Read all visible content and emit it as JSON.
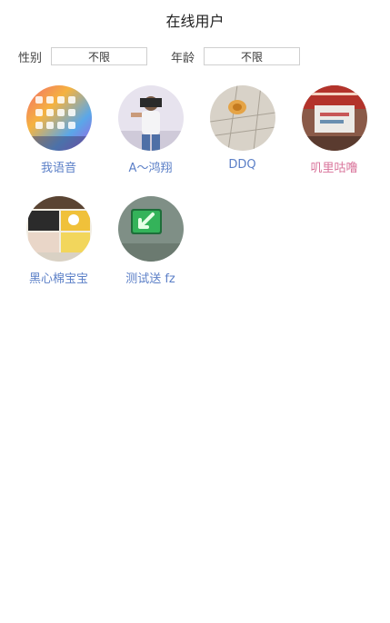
{
  "header": {
    "title": "在线用户"
  },
  "filters": {
    "gender_label": "性别",
    "gender_value": "不限",
    "age_label": "年龄",
    "age_value": "不限"
  },
  "users": [
    {
      "name": "我语音",
      "color": "#5b7fc7"
    },
    {
      "name": "A～鸿翔",
      "color": "#5b7fc7"
    },
    {
      "name": "DDQ",
      "color": "#5b7fc7"
    },
    {
      "name": "叽里咕噜",
      "color": "#d9739a"
    },
    {
      "name": "黑心棉宝宝",
      "color": "#5b7fc7"
    },
    {
      "name": "测试送 fz",
      "color": "#5b7fc7"
    }
  ]
}
